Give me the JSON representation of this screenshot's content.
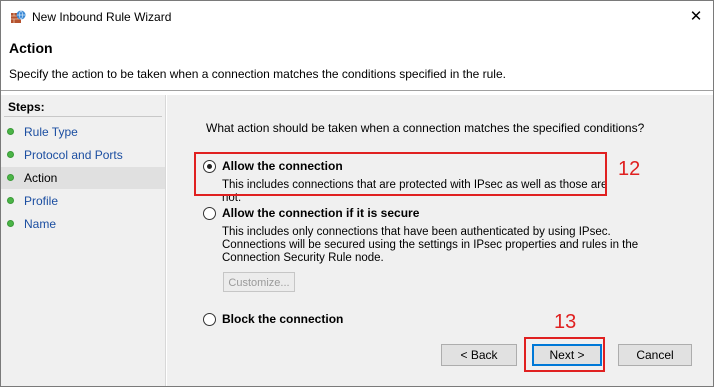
{
  "window": {
    "title": "New Inbound Rule Wizard",
    "close_glyph": "✕",
    "icon": "firewall-icon"
  },
  "header": {
    "title": "Action",
    "description": "Specify the action to be taken when a connection matches the conditions specified in the rule."
  },
  "steps": {
    "title": "Steps:",
    "items": [
      {
        "label": "Rule Type",
        "active": false
      },
      {
        "label": "Protocol and Ports",
        "active": false
      },
      {
        "label": "Action",
        "active": true
      },
      {
        "label": "Profile",
        "active": false
      },
      {
        "label": "Name",
        "active": false
      }
    ]
  },
  "main": {
    "question": "What action should be taken when a connection matches the specified conditions?",
    "options": [
      {
        "label": "Allow the connection",
        "description": "This includes connections that are protected with IPsec as well as those are not.",
        "selected": true
      },
      {
        "label": "Allow the connection if it is secure",
        "description": "This includes only connections that have been authenticated by using IPsec.  Connections will be secured using the settings in IPsec properties and rules in the Connection Security Rule node.",
        "selected": false
      },
      {
        "label": "Block the connection",
        "description": "",
        "selected": false
      }
    ],
    "customize_label": "Customize..."
  },
  "buttons": {
    "back": "< Back",
    "next": "Next >",
    "cancel": "Cancel"
  },
  "annotations": {
    "allow_option_number": "12",
    "next_button_number": "13",
    "color": "#e02020"
  }
}
